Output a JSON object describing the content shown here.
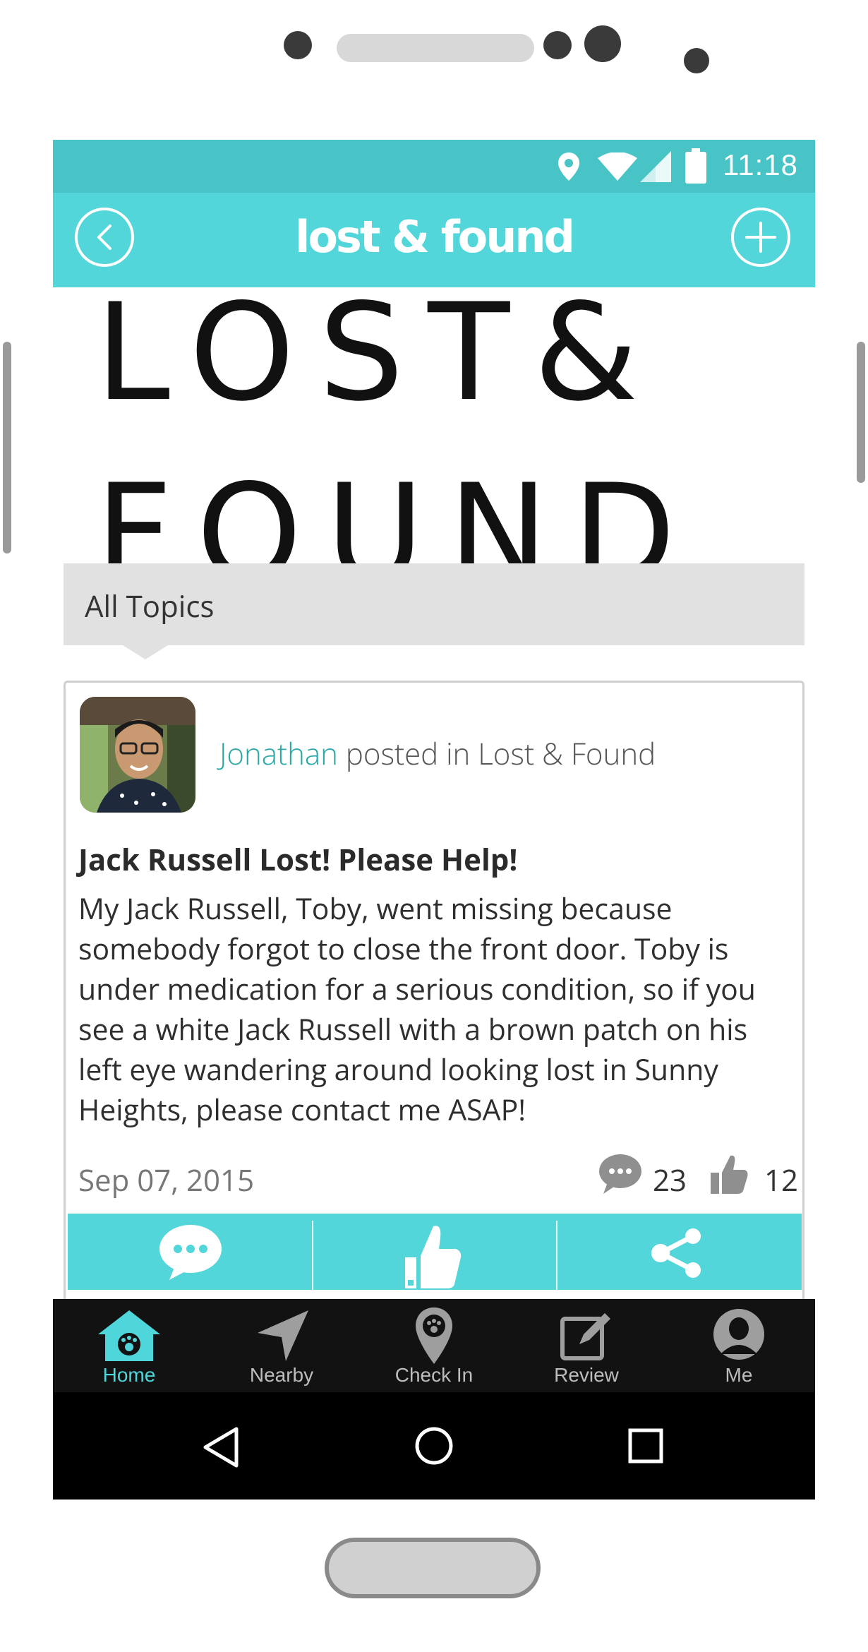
{
  "status_bar": {
    "time": "11:18",
    "icons": [
      "location-icon",
      "wifi-icon",
      "signal-icon",
      "battery-icon"
    ]
  },
  "app_bar": {
    "title": "lost & found",
    "back_icon": "chevron-left-circle-icon",
    "add_icon": "plus-circle-icon"
  },
  "banner": {
    "line1": "LOST&",
    "line2": "FOUND"
  },
  "topics": {
    "selected": "All Topics"
  },
  "post": {
    "author": "Jonathan",
    "posted_in_text": "posted in Lost & Found",
    "title": "Jack Russell Lost! Please Help!",
    "body": "My Jack Russell, Toby, went missing because somebody forgot to close the front door. Toby is under medication for a serious condition, so if you see a white Jack Russell with a brown patch on his left eye wandering around looking lost in Sunny Heights, please contact me ASAP!",
    "date": "Sep 07, 2015",
    "comment_count": "23",
    "like_count": "12",
    "actions": [
      "comment-icon",
      "thumbs-up-icon",
      "share-icon"
    ]
  },
  "bottom_nav": {
    "items": [
      {
        "label": "Home",
        "icon": "home-paw-icon",
        "active": true
      },
      {
        "label": "Nearby",
        "icon": "navigation-arrow-icon",
        "active": false
      },
      {
        "label": "Check In",
        "icon": "location-paw-icon",
        "active": false
      },
      {
        "label": "Review",
        "icon": "edit-icon",
        "active": false
      },
      {
        "label": "Me",
        "icon": "user-icon",
        "active": false
      }
    ]
  },
  "system_nav": [
    "back-triangle-icon",
    "home-circle-icon",
    "recents-square-icon"
  ],
  "colors": {
    "accent": "#52d6d9",
    "status_bar": "#48c3c6",
    "author": "#2aa8a8",
    "nav_bg": "#121212"
  }
}
